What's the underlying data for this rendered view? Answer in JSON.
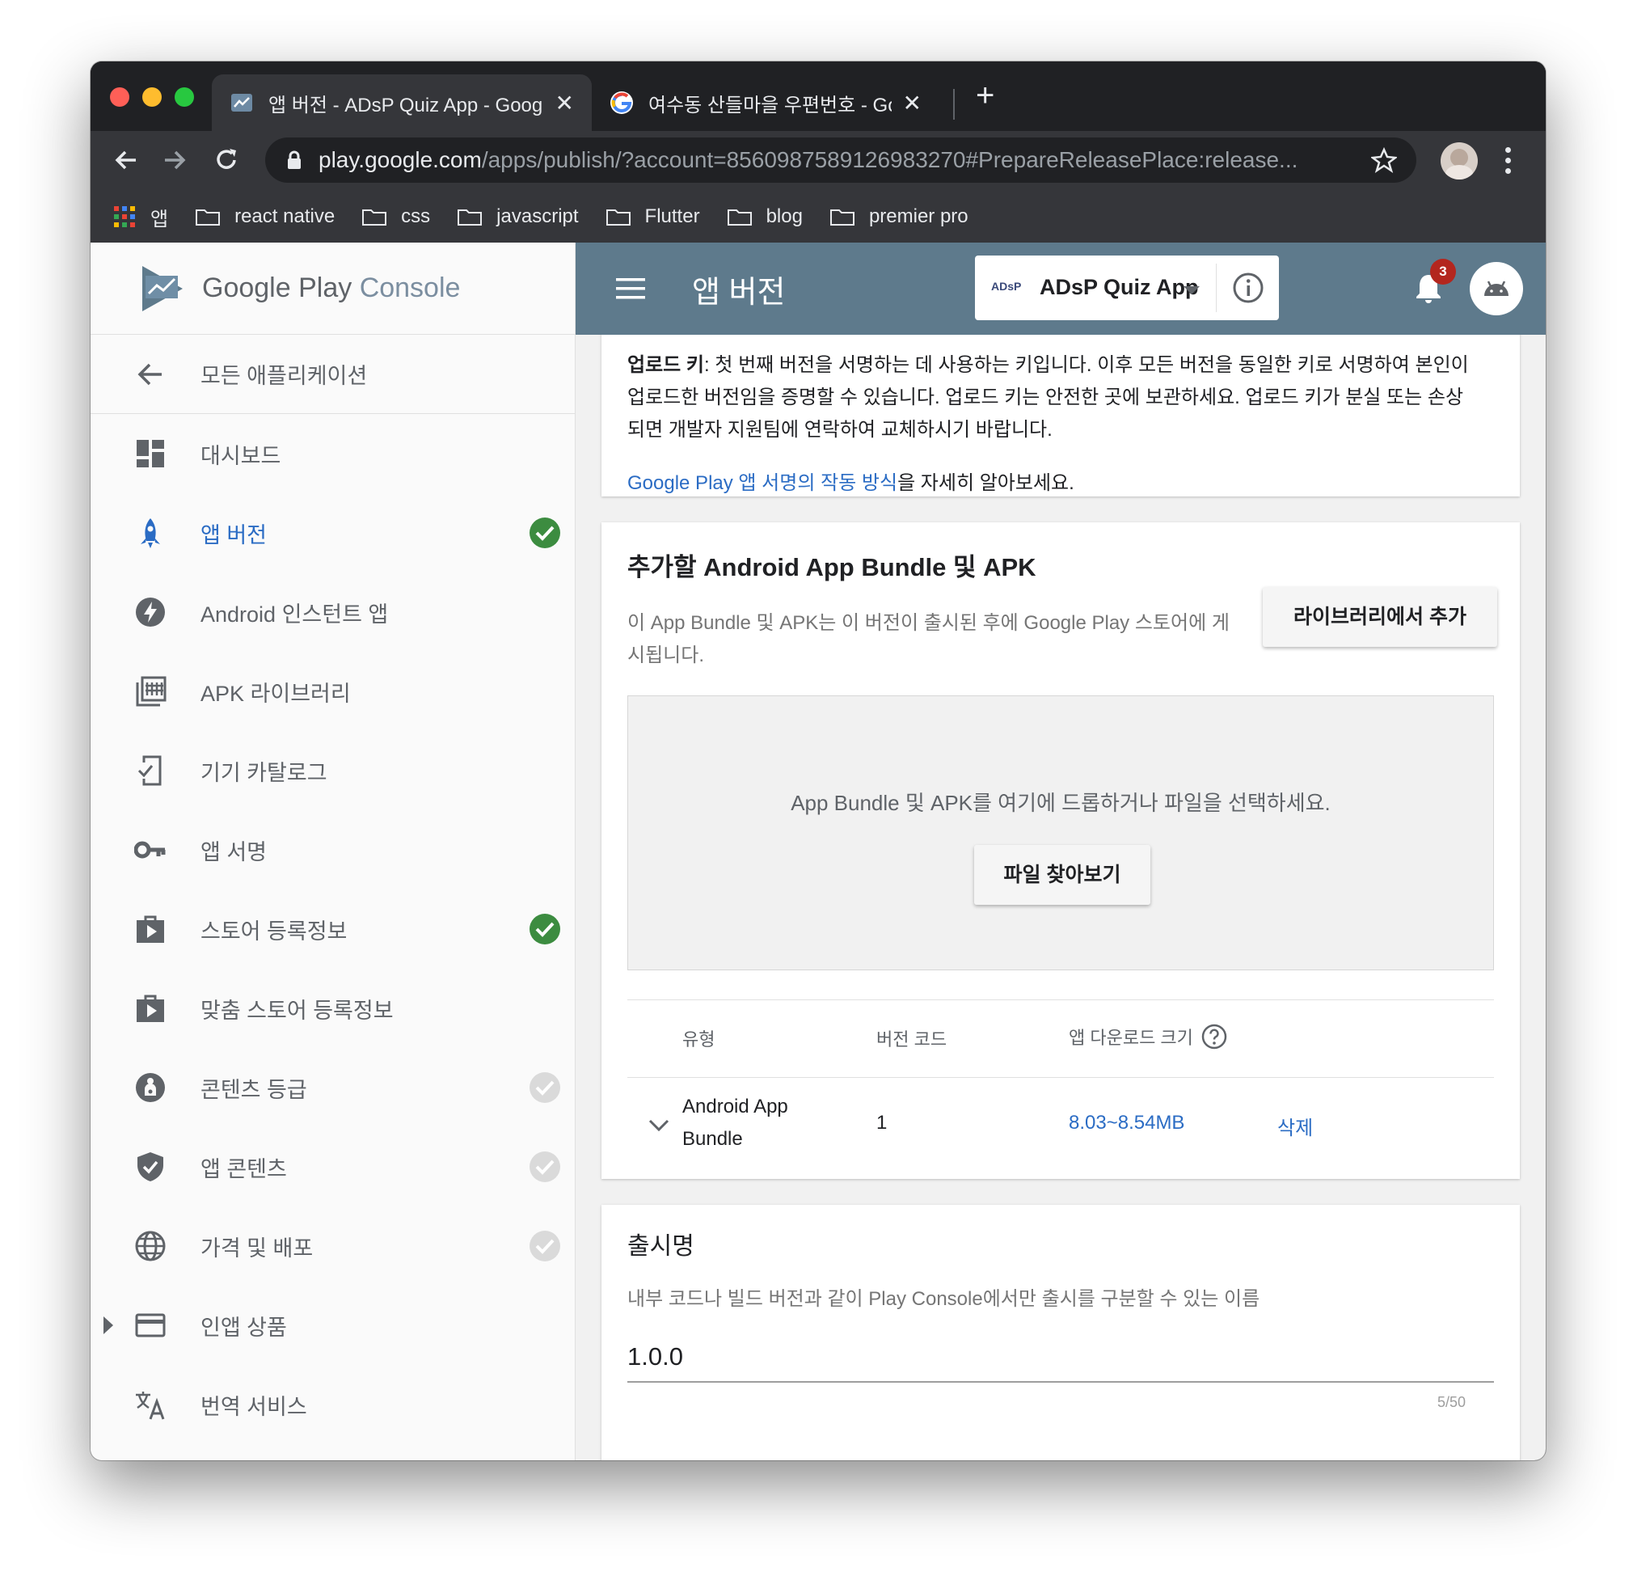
{
  "browser": {
    "tabs": [
      {
        "title": "앱 버전 - ADsP Quiz App - Goog",
        "active": true
      },
      {
        "title": "여수동 산들마을 우편번호 - Google",
        "active": false
      }
    ],
    "new_tab_label": "+",
    "url_host": "play.google.com",
    "url_rest": "/apps/publish/?account=8560987589126983270#PrepareReleasePlace:release...",
    "bookmarks": [
      "앱",
      "react native",
      "css",
      "javascript",
      "Flutter",
      "blog",
      "premier pro"
    ],
    "colors": {
      "close": "#ff5f57",
      "minimize": "#febc2e",
      "zoom": "#28c840"
    }
  },
  "brand": {
    "part1": "Google Play",
    "part2": "Console"
  },
  "sidebar": {
    "back_label": "모든 애플리케이션",
    "items": [
      {
        "label": "대시보드",
        "icon": "dashboard-icon",
        "status": "none"
      },
      {
        "label": "앱 버전",
        "icon": "rocket-icon",
        "status": "done",
        "active": true
      },
      {
        "label": "Android 인스턴트 앱",
        "icon": "bolt-icon",
        "status": "none"
      },
      {
        "label": "APK 라이브러리",
        "icon": "library-icon",
        "status": "none"
      },
      {
        "label": "기기 카탈로그",
        "icon": "device-check-icon",
        "status": "none"
      },
      {
        "label": "앱 서명",
        "icon": "key-icon",
        "status": "none"
      },
      {
        "label": "스토어 등록정보",
        "icon": "store-bag-icon",
        "status": "done"
      },
      {
        "label": "맞춤 스토어 등록정보",
        "icon": "store-bag-icon",
        "status": "none"
      },
      {
        "label": "콘텐츠 등급",
        "icon": "rating-icon",
        "status": "pending"
      },
      {
        "label": "앱 콘텐츠",
        "icon": "shield-check-icon",
        "status": "pending"
      },
      {
        "label": "가격 및 배포",
        "icon": "globe-icon",
        "status": "pending"
      },
      {
        "label": "인앱 상품",
        "icon": "card-icon",
        "status": "none",
        "expandable": true
      },
      {
        "label": "번역 서비스",
        "icon": "translate-icon",
        "status": "none"
      }
    ],
    "colors": {
      "done": "#3c8c40",
      "pending": "#dadada"
    }
  },
  "header": {
    "title": "앱 버전",
    "app_logo_text": "ADsP",
    "app_name": "ADsP Quiz App",
    "notification_count": "3",
    "color": "#5e7a8c"
  },
  "upload_key_card": {
    "bold": "업로드 키",
    "line1": ": 첫 번째 버전을 서명하는 데 사용하는 키입니다. 이후 모든 버전을 동일한 키로 서명하여 본인이",
    "line2": "업로드한 버전임을 증명할 수 있습니다. 업로드 키는 안전한 곳에 보관하세요. 업로드 키가 분실 또는 손상",
    "line3": "되면 개발자 지원팀에 연락하여 교체하시기 바랍니다.",
    "link": "Google Play 앱 서명의 작동 방식",
    "link_suffix": "을 자세히 알아보세요."
  },
  "bundle_card": {
    "title": "추가할 Android App Bundle 및 APK",
    "desc_line1": "이 App Bundle 및 APK는 이 버전이 출시된 후에 Google Play 스토어에 게",
    "desc_line2": "시됩니다.",
    "add_from_library": "라이브러리에서 추가",
    "drop_text": "App Bundle 및 APK를 여기에 드롭하거나 파일을 선택하세요.",
    "browse": "파일 찾아보기",
    "columns": [
      "유형",
      "버전 코드",
      "앱 다운로드 크기"
    ],
    "rows": [
      {
        "type_line1": "Android App",
        "type_line2": "Bundle",
        "version_code": "1",
        "size": "8.03~8.54MB",
        "action": "삭제"
      }
    ]
  },
  "release_card": {
    "title": "출시명",
    "desc": "내부 코드나 빌드 버전과 같이 Play Console에서만 출시를 구분할 수 있는 이름",
    "value": "1.0.0",
    "counter": "5/50"
  }
}
